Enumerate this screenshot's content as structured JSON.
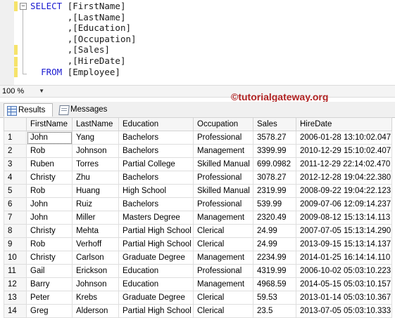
{
  "query": {
    "select_kw": "SELECT",
    "from_kw": "FROM",
    "columns": [
      "[FirstName]",
      ",[LastName]",
      ",[Education]",
      ",[Occupation]",
      ",[Sales]",
      ",[HireDate]"
    ],
    "table": "[Employee]"
  },
  "zoom": {
    "value": "100 %"
  },
  "watermark": "©tutorialgateway.org",
  "tabs": [
    {
      "label": "Results",
      "icon": "grid-icon",
      "active": true
    },
    {
      "label": "Messages",
      "icon": "messages-icon",
      "active": false
    }
  ],
  "grid": {
    "columns": [
      "",
      "FirstName",
      "LastName",
      "Education",
      "Occupation",
      "Sales",
      "HireDate"
    ],
    "rows": [
      [
        "1",
        "John",
        "Yang",
        "Bachelors",
        "Professional",
        "3578.27",
        "2006-01-28 13:10:02.047"
      ],
      [
        "2",
        "Rob",
        "Johnson",
        "Bachelors",
        "Management",
        "3399.99",
        "2010-12-29 15:10:02.407"
      ],
      [
        "3",
        "Ruben",
        "Torres",
        "Partial College",
        "Skilled Manual",
        "699.0982",
        "2011-12-29 22:14:02.470"
      ],
      [
        "4",
        "Christy",
        "Zhu",
        "Bachelors",
        "Professional",
        "3078.27",
        "2012-12-28 19:04:22.380"
      ],
      [
        "5",
        "Rob",
        "Huang",
        "High School",
        "Skilled Manual",
        "2319.99",
        "2008-09-22 19:04:22.123"
      ],
      [
        "6",
        "John",
        "Ruiz",
        "Bachelors",
        "Professional",
        "539.99",
        "2009-07-06 12:09:14.237"
      ],
      [
        "7",
        "John",
        "Miller",
        "Masters Degree",
        "Management",
        "2320.49",
        "2009-08-12 15:13:14.113"
      ],
      [
        "8",
        "Christy",
        "Mehta",
        "Partial High School",
        "Clerical",
        "24.99",
        "2007-07-05 15:13:14.290"
      ],
      [
        "9",
        "Rob",
        "Verhoff",
        "Partial High School",
        "Clerical",
        "24.99",
        "2013-09-15 15:13:14.137"
      ],
      [
        "10",
        "Christy",
        "Carlson",
        "Graduate Degree",
        "Management",
        "2234.99",
        "2014-01-25 16:14:14.110"
      ],
      [
        "11",
        "Gail",
        "Erickson",
        "Education",
        "Professional",
        "4319.99",
        "2006-10-02 05:03:10.223"
      ],
      [
        "12",
        "Barry",
        "Johnson",
        "Education",
        "Management",
        "4968.59",
        "2014-05-15 05:03:10.157"
      ],
      [
        "13",
        "Peter",
        "Krebs",
        "Graduate Degree",
        "Clerical",
        "59.53",
        "2013-01-14 05:03:10.367"
      ],
      [
        "14",
        "Greg",
        "Alderson",
        "Partial High School",
        "Clerical",
        "23.5",
        "2013-07-05 05:03:10.333"
      ]
    ]
  },
  "colors": {
    "keyword": "#1a1ad0",
    "identifier": "#1a1a1a",
    "watermark": "#b02323",
    "change_marker": "#f6e36a"
  }
}
